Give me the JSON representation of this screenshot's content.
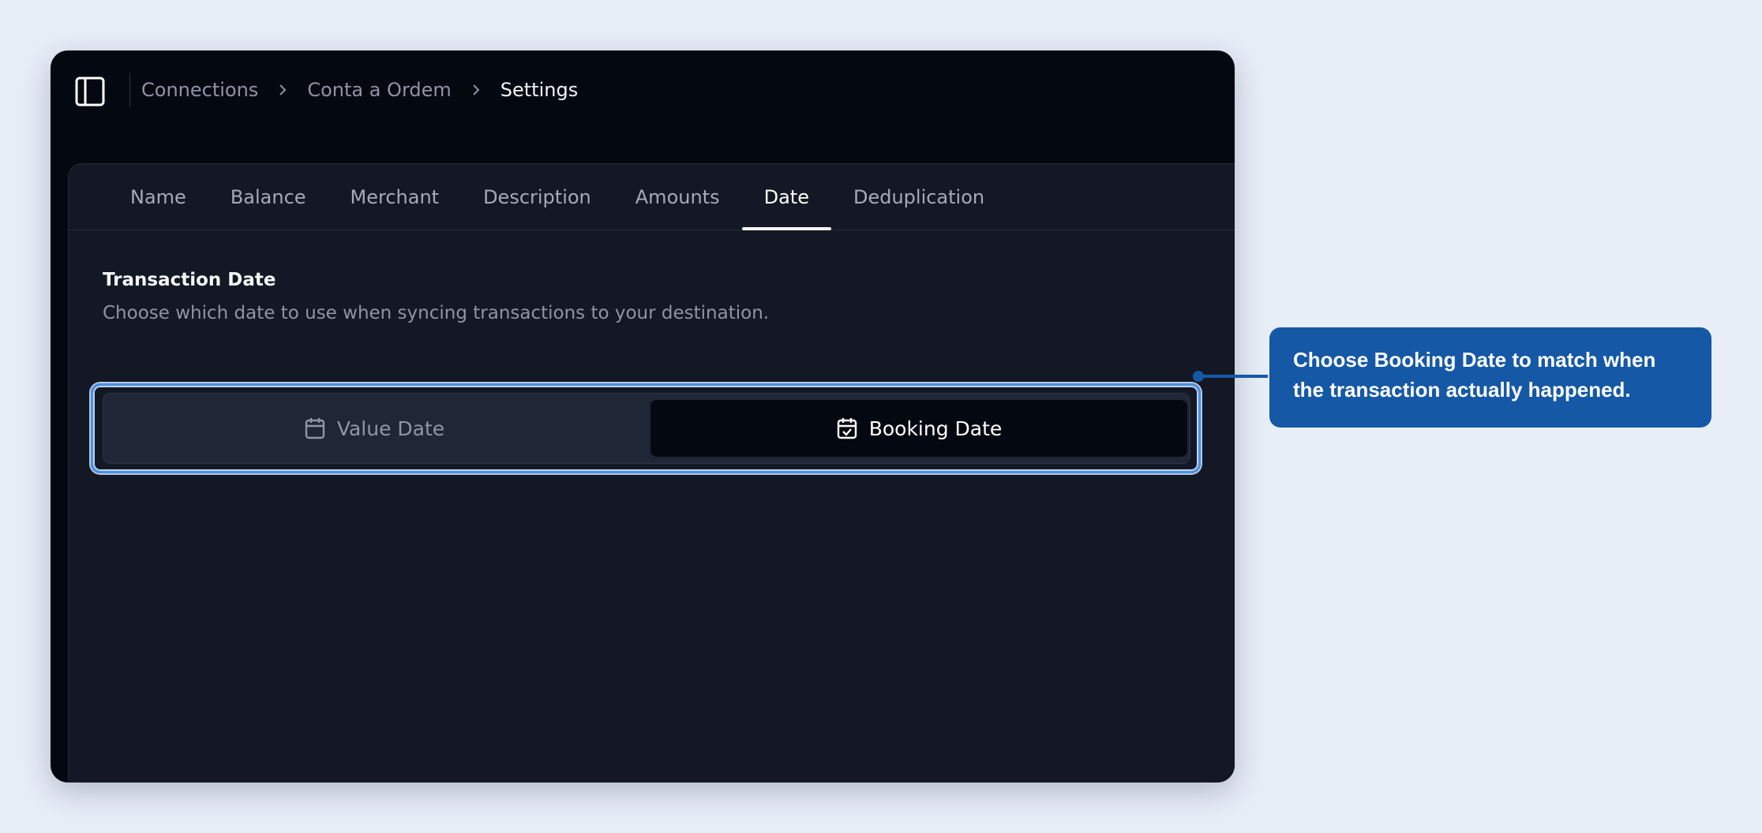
{
  "breadcrumb": {
    "items": [
      "Connections",
      "Conta a Ordem",
      "Settings"
    ]
  },
  "tabs": [
    {
      "label": "Name"
    },
    {
      "label": "Balance"
    },
    {
      "label": "Merchant"
    },
    {
      "label": "Description"
    },
    {
      "label": "Amounts"
    },
    {
      "label": "Date",
      "active": true
    },
    {
      "label": "Deduplication"
    }
  ],
  "section": {
    "title": "Transaction Date",
    "description": "Choose which date to use when syncing transactions to your destination."
  },
  "date_toggle": {
    "options": [
      {
        "label": "Value Date",
        "icon": "calendar-icon",
        "selected": false
      },
      {
        "label": "Booking Date",
        "icon": "calendar-check-icon",
        "selected": true
      }
    ]
  },
  "callout": {
    "text": "Choose Booking Date to match when the transaction actually happened."
  },
  "colors": {
    "page_background": "#e8eef8",
    "window_background": "#040811",
    "panel_background": "#131824",
    "callout_background": "#1558a6",
    "highlight_ring": "#4a90e2"
  }
}
